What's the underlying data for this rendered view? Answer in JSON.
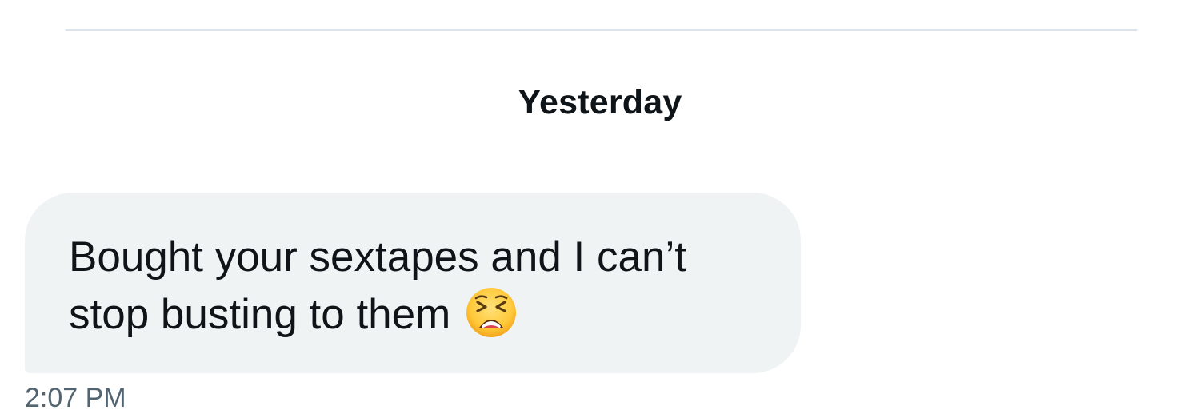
{
  "conversation": {
    "date_separator": "Yesterday",
    "messages": [
      {
        "text": "Bought your sextapes and I can’t stop busting to them",
        "emoji": "tired-face-icon",
        "timestamp": "2:07 PM"
      }
    ]
  },
  "colors": {
    "bubble_bg": "#eff3f4",
    "text": "#0f1419",
    "secondary_text": "#536471",
    "divider": "#dde3ea"
  }
}
